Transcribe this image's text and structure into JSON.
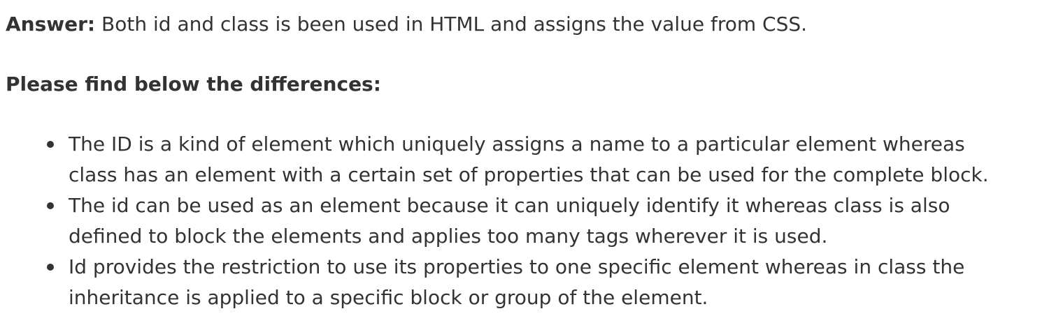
{
  "answer": {
    "label": "Answer:",
    "text": " Both id and class is been used in HTML and assigns the value from CSS."
  },
  "heading": "Please find below the differences:",
  "differences": [
    {
      "line1": "The ID is a kind of element which uniquely assigns a name to a particular element whereas",
      "line2": "class has an element with a certain set of properties that can be used for the complete block."
    },
    {
      "line1": "The id can be used as an element because it can uniquely identify it whereas class is also",
      "line2": "defined to block the elements and applies too many tags wherever it is used."
    },
    {
      "line1": "Id provides the restriction to use its properties to one specific element whereas in class the",
      "line2": "inheritance is applied to a specific block or group of the element."
    }
  ]
}
